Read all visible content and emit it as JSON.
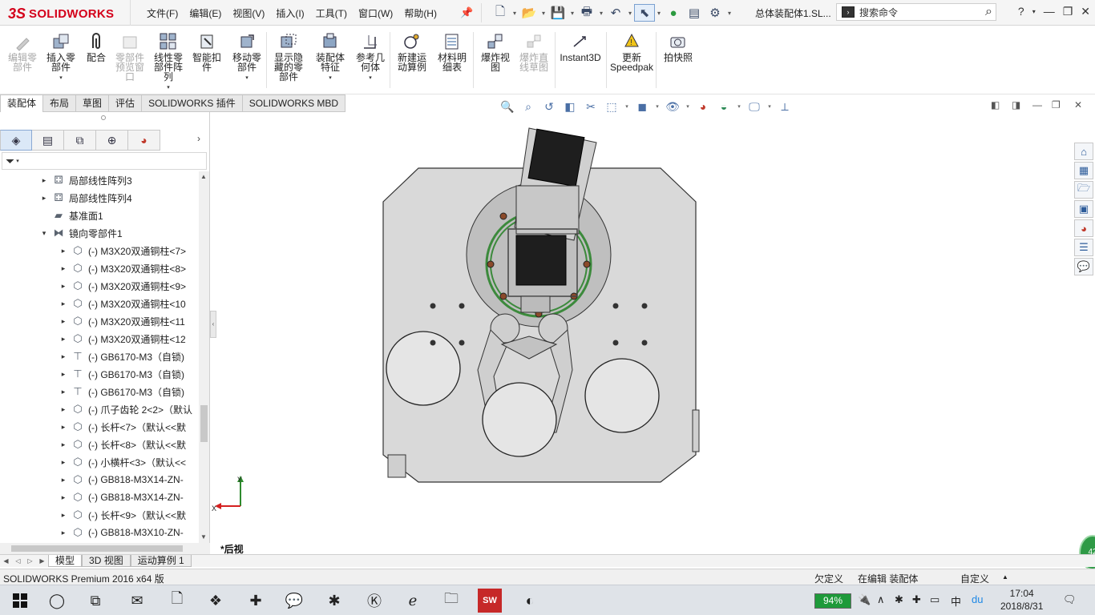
{
  "brand": {
    "ds": "3S",
    "name": "SOLIDWORKS"
  },
  "menu": [
    "文件(F)",
    "编辑(E)",
    "视图(V)",
    "插入(I)",
    "工具(T)",
    "窗口(W)",
    "帮助(H)"
  ],
  "document_title": "总体装配体1.SL...",
  "search": {
    "placeholder": "搜索命令"
  },
  "commands": [
    {
      "label": "编辑零部件",
      "enabled": false
    },
    {
      "label": "插入零部件",
      "enabled": true
    },
    {
      "label": "配合",
      "enabled": true
    },
    {
      "label": "零部件预览窗口",
      "enabled": false
    },
    {
      "label": "线性零部件阵列",
      "enabled": true
    },
    {
      "label": "智能扣件",
      "enabled": true
    },
    {
      "label": "移动零部件",
      "enabled": true
    },
    {
      "label": "显示隐藏的零部件",
      "enabled": true
    },
    {
      "label": "装配体特征",
      "enabled": true
    },
    {
      "label": "参考几何体",
      "enabled": true
    },
    {
      "label": "新建运动算例",
      "enabled": true
    },
    {
      "label": "材料明细表",
      "enabled": true
    },
    {
      "label": "爆炸视图",
      "enabled": true
    },
    {
      "label": "爆炸直线草图",
      "enabled": false
    },
    {
      "label": "Instant3D",
      "enabled": true
    },
    {
      "label": "更新Speedpak",
      "enabled": true
    },
    {
      "label": "拍快照",
      "enabled": true
    }
  ],
  "tabs": [
    "装配体",
    "布局",
    "草图",
    "评估",
    "SOLIDWORKS 插件",
    "SOLIDWORKS MBD"
  ],
  "active_tab": "装配体",
  "tree_items": [
    {
      "label": "局部线性阵列3",
      "icon": "pattern-icon",
      "depth": 1,
      "expand": "▸"
    },
    {
      "label": "局部线性阵列4",
      "icon": "pattern-icon",
      "depth": 1,
      "expand": "▸"
    },
    {
      "label": "基准面1",
      "icon": "plane-icon",
      "depth": 1,
      "expand": ""
    },
    {
      "label": "镜向零部件1",
      "icon": "mirror-icon",
      "depth": 1,
      "expand": "▾"
    },
    {
      "label": "(-) M3X20双通铜柱<7>",
      "icon": "part-icon",
      "depth": 2,
      "expand": "▸"
    },
    {
      "label": "(-) M3X20双通铜柱<8>",
      "icon": "part-icon",
      "depth": 2,
      "expand": "▸"
    },
    {
      "label": "(-) M3X20双通铜柱<9>",
      "icon": "part-icon",
      "depth": 2,
      "expand": "▸"
    },
    {
      "label": "(-) M3X20双通铜柱<10",
      "icon": "part-icon",
      "depth": 2,
      "expand": "▸"
    },
    {
      "label": "(-) M3X20双通铜柱<11",
      "icon": "part-icon",
      "depth": 2,
      "expand": "▸"
    },
    {
      "label": "(-) M3X20双通铜柱<12",
      "icon": "part-icon",
      "depth": 2,
      "expand": "▸"
    },
    {
      "label": "(-) GB6170-M3（自锁)",
      "icon": "fastener-icon",
      "depth": 2,
      "expand": "▸"
    },
    {
      "label": "(-) GB6170-M3（自锁)",
      "icon": "fastener-icon",
      "depth": 2,
      "expand": "▸"
    },
    {
      "label": "(-) GB6170-M3（自锁)",
      "icon": "fastener-icon",
      "depth": 2,
      "expand": "▸"
    },
    {
      "label": "(-) 爪子齿轮 2<2>（默认",
      "icon": "part-icon",
      "depth": 2,
      "expand": "▸"
    },
    {
      "label": "(-) 长杆<7>（默认<<默",
      "icon": "part-icon",
      "depth": 2,
      "expand": "▸"
    },
    {
      "label": "(-) 长杆<8>（默认<<默",
      "icon": "part-icon",
      "depth": 2,
      "expand": "▸"
    },
    {
      "label": "(-) 小横杆<3>（默认<<",
      "icon": "part-icon",
      "depth": 2,
      "expand": "▸"
    },
    {
      "label": "(-) GB818-M3X14-ZN-",
      "icon": "part-icon",
      "depth": 2,
      "expand": "▸"
    },
    {
      "label": "(-) GB818-M3X14-ZN-",
      "icon": "part-icon",
      "depth": 2,
      "expand": "▸"
    },
    {
      "label": "(-) 长杆<9>（默认<<默",
      "icon": "part-icon",
      "depth": 2,
      "expand": "▸"
    },
    {
      "label": "(-) GB818-M3X10-ZN-",
      "icon": "part-icon",
      "depth": 2,
      "expand": "▸"
    }
  ],
  "view_name": "*后视",
  "triad": {
    "x": "X",
    "y": "Y"
  },
  "bottom_tabs": [
    "模型",
    "3D 视图",
    "运动算例 1"
  ],
  "active_bottom_tab": "模型",
  "status": {
    "product": "SOLIDWORKS Premium 2016 x64 版",
    "constraint": "欠定义",
    "mode": "在编辑 装配体",
    "units": "自定义",
    "notify_count": "42"
  },
  "taskbar": {
    "battery": "94%",
    "ime": "中",
    "time": "17:04",
    "date": "2018/8/31"
  },
  "colors": {
    "brand_red": "#d4001a",
    "battery_green": "#1e9a3a",
    "plate_gray": "#dcdcdc",
    "ring_green": "#3c8a3c"
  }
}
